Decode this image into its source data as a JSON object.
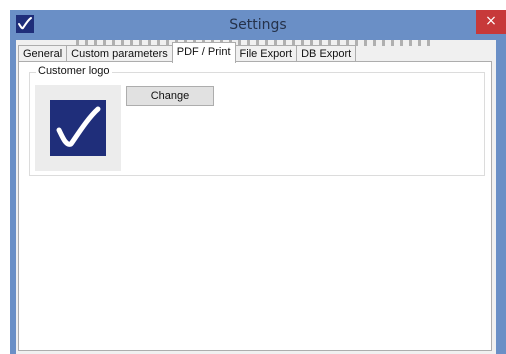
{
  "window": {
    "title": "Settings",
    "close_glyph": "×"
  },
  "tabs": [
    {
      "label": "General"
    },
    {
      "label": "Custom parameters"
    },
    {
      "label": "PDF / Print",
      "active": true
    },
    {
      "label": "File Export"
    },
    {
      "label": "DB Export"
    }
  ],
  "panel": {
    "group_label": "Customer logo",
    "change_label": "Change"
  },
  "icons": {
    "app_icon": "checkmark-logo-icon",
    "logo_image": "checkmark-logo-icon"
  },
  "colors": {
    "titlebar": "#6a8fc6",
    "close": "#c7393a",
    "logo": "#1f2e7a"
  }
}
